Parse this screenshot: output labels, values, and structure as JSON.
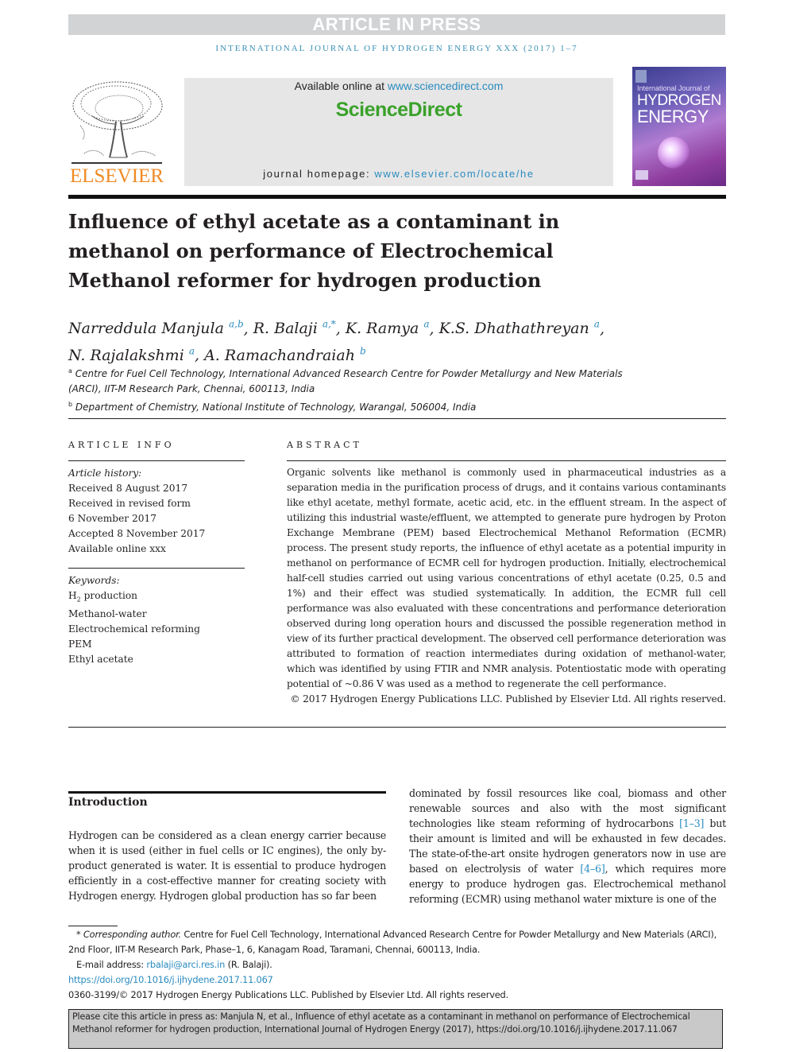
{
  "banner": {
    "label": "ARTICLE IN PRESS"
  },
  "journal_running_head": "INTERNATIONAL JOURNAL OF HYDROGEN ENERGY XXX (2017) 1–7",
  "publisher": {
    "name": "ELSEVIER"
  },
  "sciencedirect": {
    "available_prefix": "Available online at ",
    "available_link": "www.sciencedirect.com",
    "logo_text": "ScienceDirect",
    "homepage_prefix": "journal homepage: ",
    "homepage_link": "www.elsevier.com/locate/he"
  },
  "cover": {
    "small_line": "International Journal of",
    "title_line1": "HYDROGEN",
    "title_line2": "ENERGY"
  },
  "article": {
    "title": "Influence of ethyl acetate as a contaminant in methanol on performance of Electrochemical Methanol reformer for hydrogen production",
    "authors": [
      {
        "name": "Narreddula Manjula",
        "sup": "a,b",
        "sep": ", "
      },
      {
        "name": "R. Balaji",
        "sup": "a,*",
        "sep": ", "
      },
      {
        "name": "K. Ramya",
        "sup": "a",
        "sep": ", "
      },
      {
        "name": "K.S. Dhathathreyan",
        "sup": "a",
        "sep": ", "
      },
      {
        "name": "N. Rajalakshmi",
        "sup": "a",
        "sep": ", "
      },
      {
        "name": "A. Ramachandraiah",
        "sup": "b",
        "sep": ""
      }
    ],
    "affiliations": [
      {
        "mark": "a",
        "text": "Centre for Fuel Cell Technology, International Advanced Research Centre for Powder Metallurgy and New Materials (ARCI), IIT-M Research Park, Chennai, 600113, India"
      },
      {
        "mark": "b",
        "text": "Department of Chemistry, National Institute of Technology, Warangal, 506004, India"
      }
    ]
  },
  "article_info": {
    "heading": "ARTICLE INFO",
    "history_label": "Article history:",
    "history": [
      "Received 8 August 2017",
      "Received in revised form",
      "6 November 2017",
      "Accepted 8 November 2017",
      "Available online xxx"
    ],
    "keywords_label": "Keywords:",
    "keywords_first_base": "H",
    "keywords_first_sub": "2",
    "keywords_first_rest": " production",
    "keywords": [
      "Methanol-water",
      "Electrochemical reforming",
      "PEM",
      "Ethyl acetate"
    ]
  },
  "abstract": {
    "heading": "ABSTRACT",
    "text": "Organic solvents like methanol is commonly used in pharmaceutical industries as a separation media in the purification process of drugs, and it contains various contaminants like ethyl acetate, methyl formate, acetic acid, etc. in the effluent stream. In the aspect of utilizing this industrial waste/effluent, we attempted to generate pure hydrogen by Proton Exchange Membrane (PEM) based Electrochemical Methanol Reformation (ECMR) process. The present study reports, the influence of ethyl acetate as a potential impurity in methanol on performance of ECMR cell for hydrogen production. Initially, electrochemical half-cell studies carried out using various concentrations of ethyl acetate (0.25, 0.5 and 1%) and their effect was studied systematically. In addition, the ECMR full cell performance was also evaluated with these concentrations and performance deterioration observed during long operation hours and discussed the possible regeneration method in view of its further practical development. The observed cell performance deterioration was attributed to formation of reaction intermediates during oxidation of methanol-water, which was identified by using FTIR and NMR analysis. Potentiostatic mode with operating potential of ~0.86 V was used as a method to regenerate the cell performance.",
    "copyright": "© 2017 Hydrogen Energy Publications LLC. Published by Elsevier Ltd. All rights reserved."
  },
  "introduction": {
    "heading": "Introduction",
    "left_text": "Hydrogen can be considered as a clean energy carrier because when it is used (either in fuel cells or IC engines), the only by-product generated is water. It is essential to produce hydrogen efficiently in a cost-effective manner for creating society with Hydrogen energy. Hydrogen global production has so far been",
    "right_part1": "dominated by fossil resources like coal, biomass and other renewable sources and also with the most significant technologies like steam reforming of hydrocarbons ",
    "right_ref1": "[1–3]",
    "right_part2": " but their amount is limited and will be exhausted in few decades. The state-of-the-art onsite hydrogen generators now in use are based on electrolysis of water ",
    "right_ref2": "[4–6]",
    "right_part3": ", which requires more energy to produce hydrogen gas. Electrochemical methanol reforming (ECMR) using methanol water mixture is one of the"
  },
  "footnotes": {
    "corresponding_label": "* Corresponding author.",
    "corresponding_text": " Centre for Fuel Cell Technology, International Advanced Research Centre for Powder Metallurgy and New Materials (ARCI), 2nd Floor, IIT-M Research Park, Phase–1, 6, Kanagam Road, Taramani, Chennai, 600113, India.",
    "email_label": "E-mail address: ",
    "email": "rbalaji@arci.res.in",
    "email_suffix": " (R. Balaji).",
    "doi": "https://doi.org/10.1016/j.ijhydene.2017.11.067",
    "issn_line": "0360-3199/© 2017 Hydrogen Energy Publications LLC. Published by Elsevier Ltd. All rights reserved."
  },
  "citation_box": {
    "text": "Please cite this article in press as: Manjula N, et al., Influence of ethyl acetate as a contaminant in methanol on performance of Electrochemical Methanol reformer for hydrogen production, International Journal of Hydrogen Energy (2017), https://doi.org/10.1016/j.ijhydene.2017.11.067"
  },
  "colors": {
    "link_blue": "#2a8bbf",
    "journal_head_blue": "#3a8fb5",
    "sciencedirect_green": "#3aa22a",
    "elsevier_orange": "#f08a24",
    "banner_gray": "#d2d3d5",
    "citation_gray": "#c9c9c9"
  }
}
